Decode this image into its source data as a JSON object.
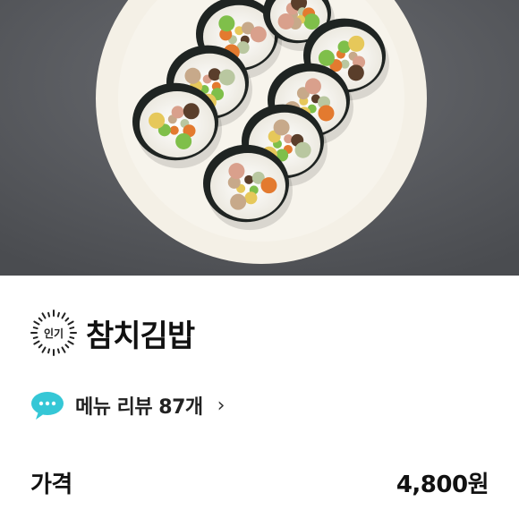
{
  "hero": {
    "image_desc": "photo-kimbap-plate"
  },
  "badge": {
    "label": "인기"
  },
  "menu": {
    "title": "참치김밥"
  },
  "reviews": {
    "label": "메뉴 리뷰 87개",
    "chevron": "›"
  },
  "price": {
    "label": "가격",
    "value": "4,800원"
  },
  "colors": {
    "background": "#5b5d62",
    "plate": "#f3efe6",
    "accent": "#35c7d6"
  }
}
